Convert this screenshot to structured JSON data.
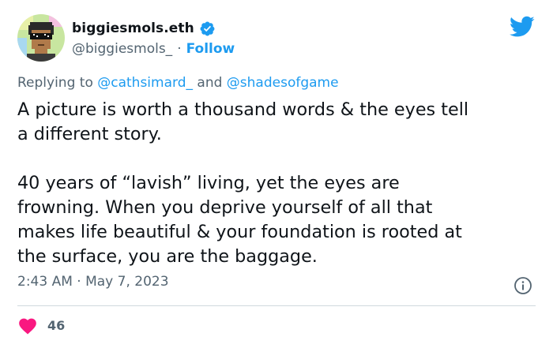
{
  "author": {
    "display_name": "biggiesmols.eth",
    "handle": "@biggiesmols_",
    "separator": "·",
    "follow_label": "Follow",
    "verified_icon": "verified-badge-icon",
    "avatar_icon": "pixel-punk-avatar"
  },
  "header": {
    "brand_icon": "twitter-bird-icon",
    "brand_color": "#1d9bf0"
  },
  "reply_context": {
    "prefix": "Replying to",
    "mention_1": "@cathsimard_",
    "conjunction": "and",
    "mention_2": "@shadesofgame"
  },
  "tweet": {
    "lines": [
      "A picture is worth a thousand words & the eyes tell",
      "a different story.",
      "",
      "40 years of “lavish” living, yet the eyes are",
      "frowning. When you deprive yourself of all that",
      "makes life beautiful & your foundation is rooted at",
      "the surface, you are the baggage."
    ]
  },
  "meta": {
    "timestamp": "2:43 AM · May 7, 2023",
    "info_icon": "info-icon"
  },
  "engagement": {
    "like_icon": "heart-icon",
    "like_color": "#f91880",
    "like_count": "46"
  }
}
